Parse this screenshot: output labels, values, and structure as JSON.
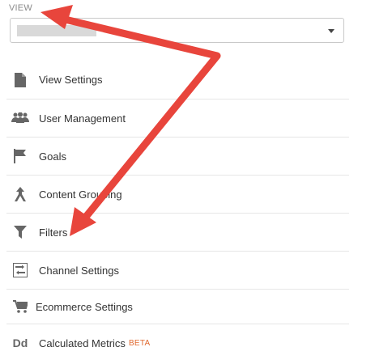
{
  "view": {
    "label": "VIEW",
    "selected_value": ""
  },
  "menu": {
    "items": [
      {
        "label": "View Settings",
        "icon": "document-icon"
      },
      {
        "label": "User Management",
        "icon": "users-icon"
      },
      {
        "label": "Goals",
        "icon": "flag-icon"
      },
      {
        "label": "Content Grouping",
        "icon": "content-grouping-icon"
      },
      {
        "label": "Filters",
        "icon": "filter-icon"
      },
      {
        "label": "Channel Settings",
        "icon": "channel-settings-icon"
      },
      {
        "label": "Ecommerce Settings",
        "icon": "cart-icon"
      },
      {
        "label": "Calculated Metrics",
        "icon": "dd-icon",
        "badge": "BETA",
        "icon_text": "Dd"
      }
    ]
  },
  "colors": {
    "annotation_arrow": "#e8453c",
    "beta_badge": "#e0692f",
    "icon": "#666666"
  }
}
